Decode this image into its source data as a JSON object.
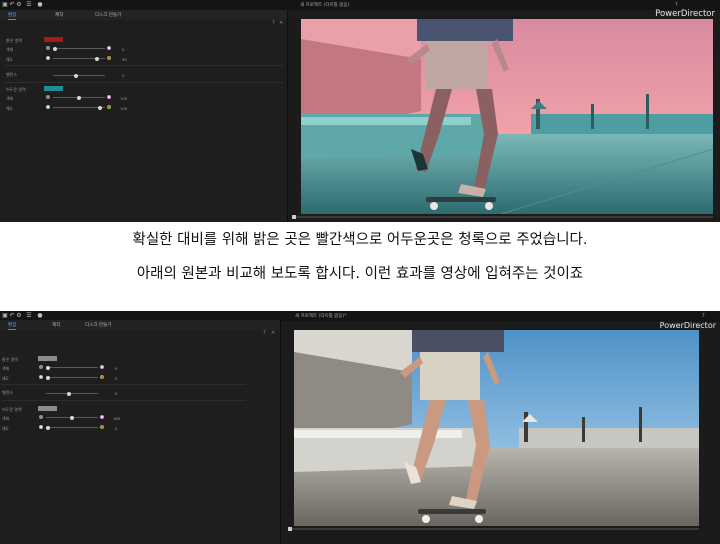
{
  "top": {
    "window_title": "새 프로젝트 (타이틀 없음)",
    "brand": "PowerDirector",
    "help": "?",
    "tabs": [
      "편집",
      "제작",
      "디스크 만들기"
    ],
    "panel_tools": [
      "?",
      "✕"
    ],
    "highlight_label": "밝은 영역",
    "highlight_color": "#a81a17",
    "highlight_rows": [
      {
        "label": "색채",
        "value": "0"
      },
      {
        "label": "채도",
        "value": "95"
      }
    ],
    "balance_label": "밸런스",
    "balance_value": "0",
    "shadow_label": "어두운 영역",
    "shadow_color": "#1f8c99",
    "shadow_rows": [
      {
        "label": "색채",
        "value": "105"
      },
      {
        "label": "채도",
        "value": "100"
      }
    ]
  },
  "caption1": "확실한 대비를 위해 밝은 곳은 빨간색으로 어두운곳은 청록으로 주었습니다.",
  "caption2": "아래의 원본과 비교해 보도록 합시다. 이런 효과를 영상에 입혀주는 것이죠",
  "bottom": {
    "window_title": "새 프로젝트 (타이틀 없음)*",
    "brand": "PowerDirector",
    "help": "?",
    "tabs": [
      "편집",
      "제작",
      "디스크 만들기"
    ],
    "panel_tools": [
      "?",
      "✕"
    ],
    "highlight_label": "밝은 영역",
    "highlight_color": "#8c8c8c",
    "highlight_rows": [
      {
        "label": "색채",
        "value": "0"
      },
      {
        "label": "채도",
        "value": "0"
      }
    ],
    "balance_label": "밸런스",
    "balance_value": "0",
    "shadow_label": "어두운 영역",
    "shadow_color": "#8c8c8c",
    "shadow_rows": [
      {
        "label": "색채",
        "value": "185"
      },
      {
        "label": "채도",
        "value": "0"
      }
    ]
  }
}
